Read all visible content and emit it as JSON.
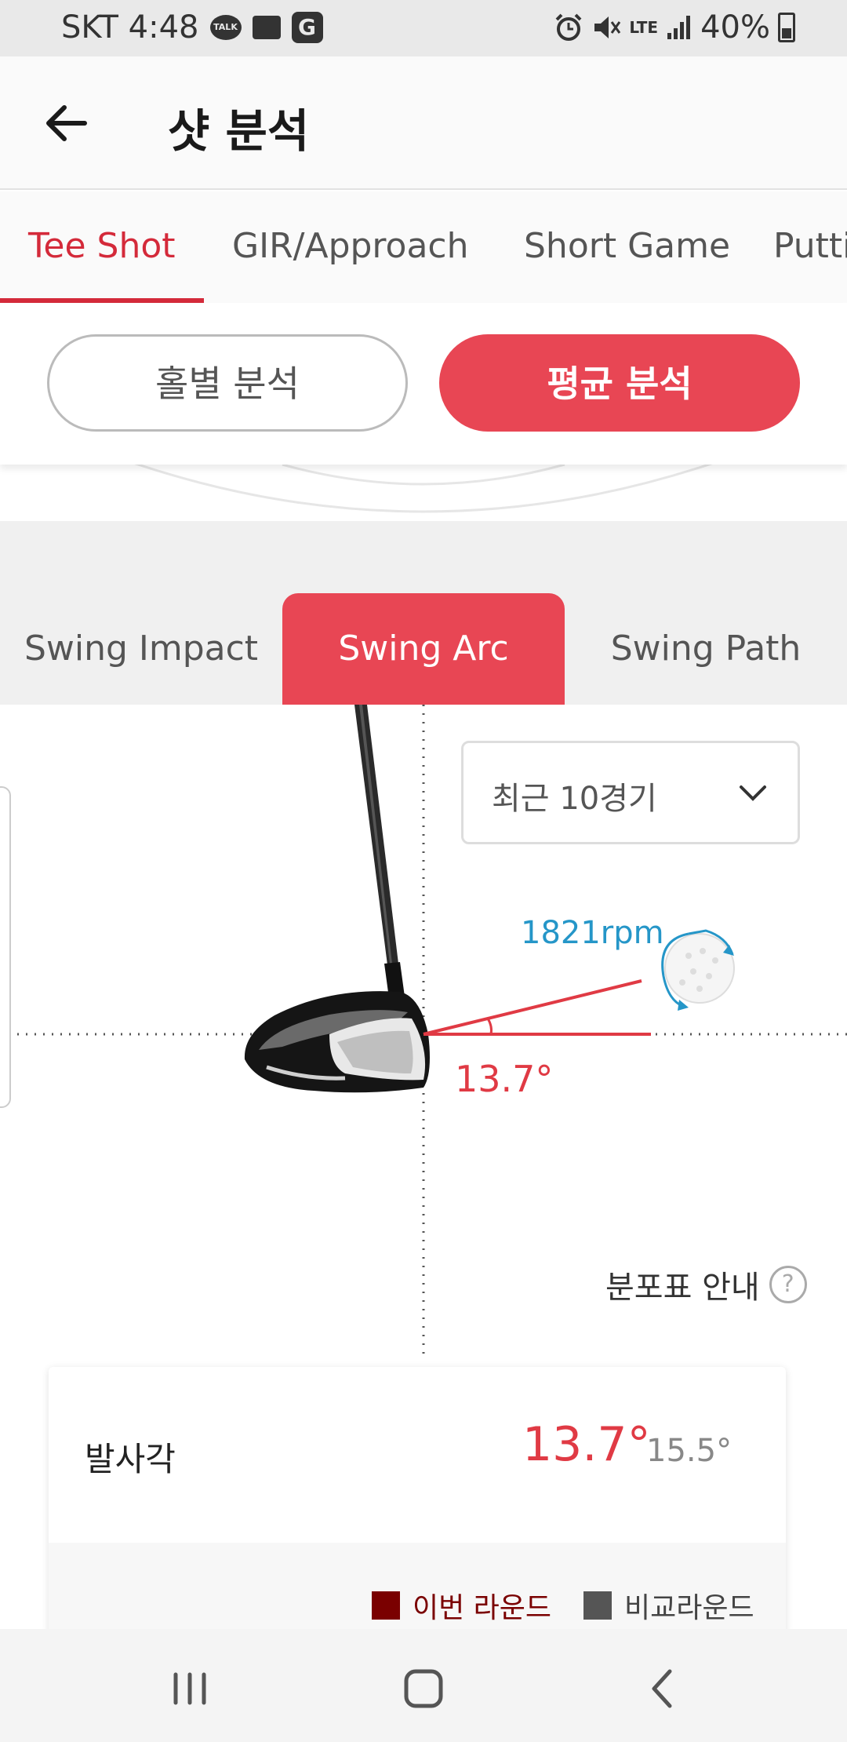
{
  "status_bar": {
    "carrier_time": "SKT 4:48",
    "talk_icon_text": "TALK",
    "g_icon_text": "G",
    "lte_text": "LTE",
    "battery_text": "40%"
  },
  "header": {
    "title": "샷 분석"
  },
  "top_tabs": [
    {
      "label": "Tee Shot",
      "active": true
    },
    {
      "label": "GIR/Approach",
      "active": false
    },
    {
      "label": "Short Game",
      "active": false
    },
    {
      "label": "Putti",
      "active": false
    }
  ],
  "segment": {
    "hole_label": "홀별 분석",
    "avg_label": "평균 분석"
  },
  "swing_tabs": [
    {
      "label": "Swing Impact",
      "active": false
    },
    {
      "label": "Swing Arc",
      "active": true
    },
    {
      "label": "Swing Path",
      "active": false
    }
  ],
  "diagram": {
    "dropdown_value": "최근 10경기",
    "spin": "1821rpm",
    "angle": "13.7°",
    "guide_label": "분포표 안내",
    "help_icon_text": "?"
  },
  "card": {
    "label": "발사각",
    "value": "13.7°",
    "compare": "15.5°",
    "legend": [
      {
        "label": "이번 라운드",
        "color": "#7a0000"
      },
      {
        "label": "비교라운드",
        "color": "#555555"
      }
    ]
  },
  "colors": {
    "accent": "#e84654",
    "accent_text": "#d42a3a",
    "spin_blue": "#2596c8"
  }
}
